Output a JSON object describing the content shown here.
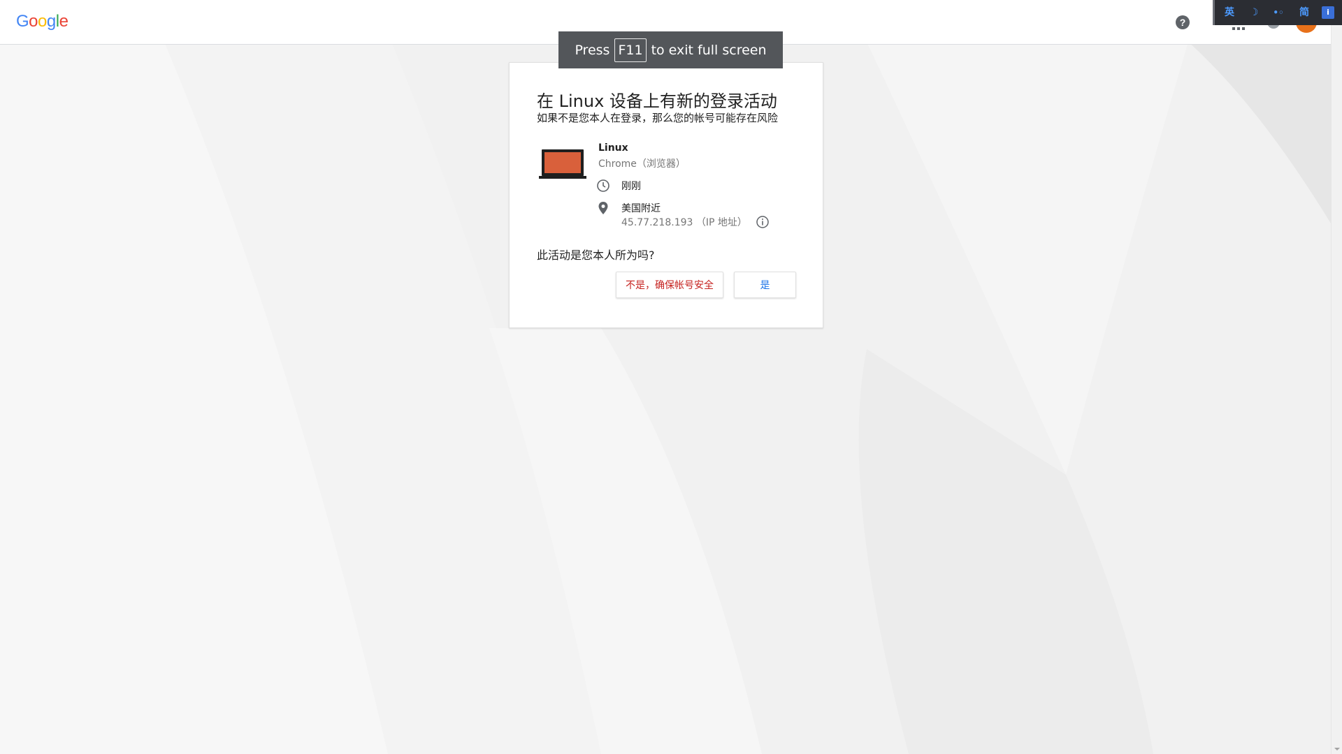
{
  "header": {
    "logo_letters": [
      {
        "char": "G",
        "color": "#4285f4"
      },
      {
        "char": "o",
        "color": "#ea4335"
      },
      {
        "char": "o",
        "color": "#fbbc05"
      },
      {
        "char": "g",
        "color": "#4285f4"
      },
      {
        "char": "l",
        "color": "#34a853"
      },
      {
        "char": "e",
        "color": "#ea4335"
      }
    ],
    "icons": [
      "help-icon",
      "apps-icon",
      "notification-icon",
      "avatar"
    ]
  },
  "ime": {
    "lang": "英",
    "moon": "☽",
    "dots": "•◦",
    "mode": "简",
    "tool": "i"
  },
  "fullscreen_toast": {
    "before": "Press",
    "key": "F11",
    "after": "to exit full screen"
  },
  "card": {
    "title": "在 Linux 设备上有新的登录活动",
    "subtitle": "如果不是您本人在登录，那么您的帐号可能存在风险",
    "device_name": "Linux",
    "device_browser": "Chrome（浏览器）",
    "time": "刚刚",
    "location": "美国附近",
    "ip": "45.77.218.193 （IP 地址）",
    "question": "此活动是您本人所为吗?",
    "no_button": "不是，确保帐号安全",
    "yes_button": "是"
  },
  "colors": {
    "no_button": "#c5221f",
    "yes_button": "#1a73e8",
    "avatar": "#e8711a",
    "laptop_screen": "#d9603b"
  }
}
